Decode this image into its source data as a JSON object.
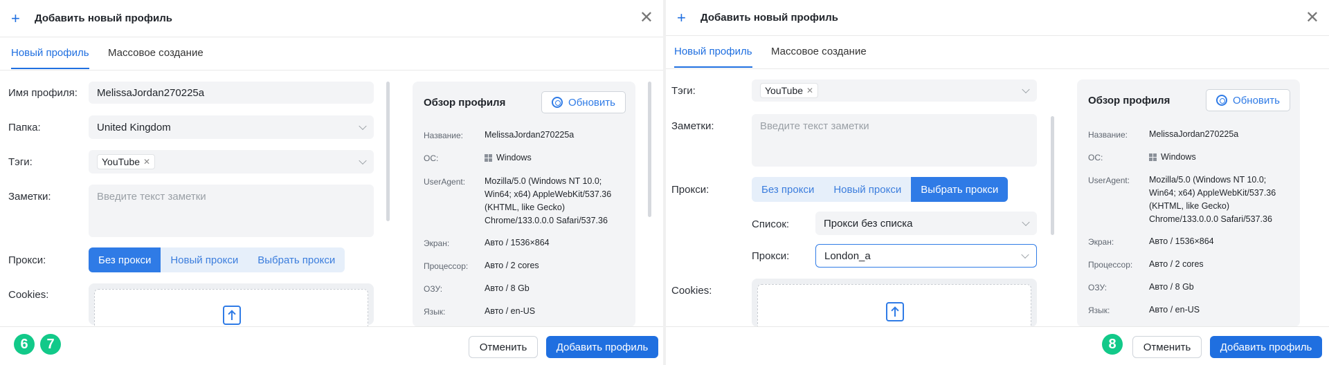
{
  "dialog": {
    "title": "Добавить новый профиль",
    "tabs": [
      "Новый профиль",
      "Массовое создание"
    ]
  },
  "form": {
    "profile_name_label": "Имя профиля:",
    "profile_name_value": "MelissaJordan270225a",
    "folder_label": "Папка:",
    "folder_value": "United Kingdom",
    "tags_label": "Тэги:",
    "tag_value": "YouTube",
    "notes_label": "Заметки:",
    "notes_placeholder": "Введите текст заметки",
    "proxy_label": "Прокси:",
    "proxy_options": [
      "Без прокси",
      "Новый прокси",
      "Выбрать прокси"
    ],
    "list_label": "Список:",
    "list_value": "Прокси без списка",
    "proxy_select_label": "Прокси:",
    "proxy_select_value": "London_a",
    "cookies_label": "Cookies:"
  },
  "overview": {
    "title": "Обзор профиля",
    "refresh_label": "Обновить",
    "rows": [
      {
        "key": "Название:",
        "value": "MelissaJordan270225a"
      },
      {
        "key": "ОС:",
        "value": "Windows"
      },
      {
        "key": "UserAgent:",
        "lines": [
          "Mozilla/5.0 (Windows NT 10.0;",
          "Win64; x64) AppleWebKit/537.36",
          "(KHTML, like Gecko)",
          "Chrome/133.0.0.0 Safari/537.36"
        ]
      },
      {
        "key": "Экран:",
        "value": "Авто / 1536×864"
      },
      {
        "key": "Процессор:",
        "value": "Авто / 2 cores"
      },
      {
        "key": "ОЗУ:",
        "value": "Авто / 8 Gb"
      },
      {
        "key": "Язык:",
        "value": "Авто / en-US"
      }
    ]
  },
  "footer": {
    "cancel_label": "Отменить",
    "add_label": "Добавить профиль"
  },
  "badges": [
    "6",
    "7",
    "8"
  ],
  "colors": {
    "accent": "#1f6fe0",
    "badge": "#12c989"
  }
}
